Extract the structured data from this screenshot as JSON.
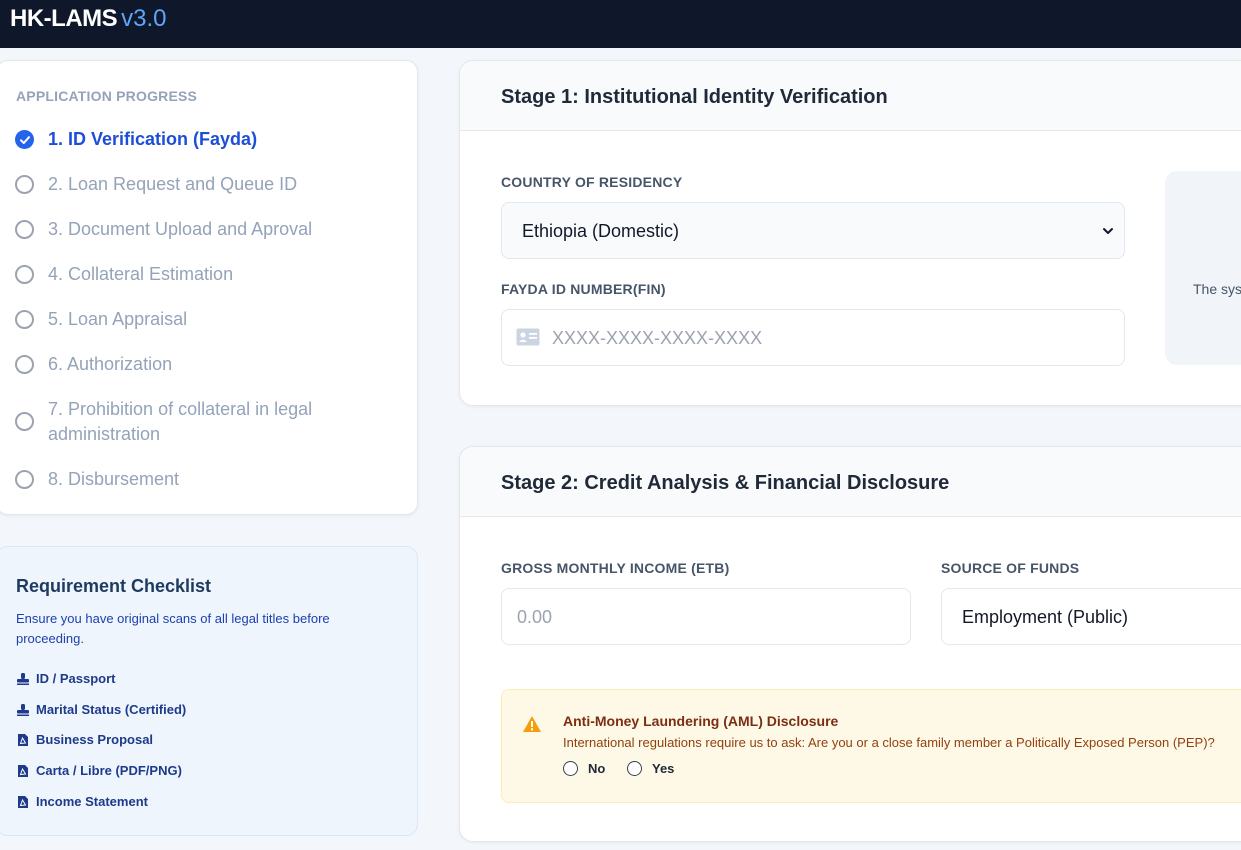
{
  "app": {
    "name": "HK-LAMS",
    "version": "v3.0"
  },
  "progress": {
    "title": "APPLICATION PROGRESS",
    "steps": [
      {
        "label": "1. ID Verification (Fayda)",
        "state": "active"
      },
      {
        "label": "2. Loan Request and Queue ID",
        "state": "pending"
      },
      {
        "label": "3. Document Upload and Aproval",
        "state": "pending"
      },
      {
        "label": "4. Collateral Estimation",
        "state": "pending"
      },
      {
        "label": "5. Loan Appraisal",
        "state": "pending"
      },
      {
        "label": "6. Authorization",
        "state": "pending"
      },
      {
        "label": "7. Prohibition of collateral in legal administration",
        "state": "pending"
      },
      {
        "label": "8. Disbursement",
        "state": "pending"
      }
    ]
  },
  "checklist": {
    "title": "Requirement Checklist",
    "description": "Ensure you have original scans of all legal titles before proceeding.",
    "items": [
      {
        "label": "ID / Passport",
        "icon": "stamp-icon"
      },
      {
        "label": "Marital Status (Certified)",
        "icon": "stamp-icon"
      },
      {
        "label": "Business Proposal",
        "icon": "pdf-file-icon"
      },
      {
        "label": "Carta / Libre (PDF/PNG)",
        "icon": "pdf-file-icon"
      },
      {
        "label": "Income Statement",
        "icon": "pdf-file-icon"
      }
    ]
  },
  "stage1": {
    "title": "Stage 1: Institutional Identity Verification",
    "country_label": "COUNTRY OF RESIDENCY",
    "country_value": "Ethiopia (Domestic)",
    "fayda_label": "FAYDA ID NUMBER(FIN)",
    "fayda_placeholder": "XXXX-XXXX-XXXX-XXXX",
    "info_text": "The sys"
  },
  "stage2": {
    "title": "Stage 2: Credit Analysis & Financial Disclosure",
    "income_label": "GROSS MONTHLY INCOME (ETB)",
    "income_placeholder": "0.00",
    "source_label": "SOURCE OF FUNDS",
    "source_value": "Employment (Public)",
    "aml": {
      "title": "Anti-Money Laundering (AML) Disclosure",
      "text": "International regulations require us to ask: Are you or a close family member a Politically Exposed Person (PEP)?",
      "option_no": "No",
      "option_yes": "Yes"
    }
  },
  "colors": {
    "topbar": "#0f172a",
    "accent": "#2563eb",
    "warning": "#f59e0b"
  }
}
